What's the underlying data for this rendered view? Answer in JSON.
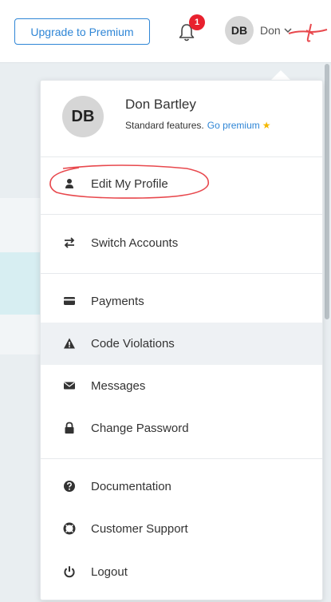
{
  "header": {
    "upgrade_label": "Upgrade to Premium",
    "notification_count": "1",
    "avatar_initials": "DB",
    "user_short_name": "Don"
  },
  "profile": {
    "avatar_initials": "DB",
    "full_name": "Don Bartley",
    "plan_text": "Standard features.",
    "go_premium_label": "Go premium",
    "star_glyph": "★"
  },
  "menu": {
    "edit_profile": "Edit My Profile",
    "switch_accounts": "Switch Accounts",
    "payments": "Payments",
    "code_violations": "Code Violations",
    "messages": "Messages",
    "change_password": "Change Password",
    "documentation": "Documentation",
    "customer_support": "Customer Support",
    "logout": "Logout"
  },
  "icons": {
    "edit_profile": "user-icon",
    "switch_accounts": "switch-arrows-icon",
    "payments": "credit-card-icon",
    "code_violations": "warning-icon",
    "messages": "envelope-icon",
    "change_password": "lock-icon",
    "documentation": "question-circle-icon",
    "customer_support": "lifebuoy-icon",
    "logout": "power-icon"
  },
  "colors": {
    "accent": "#2f86d6",
    "badge": "#e8212e",
    "annotation": "#e8484d",
    "active_row": "#eef1f4"
  },
  "active_item": "code_violations"
}
